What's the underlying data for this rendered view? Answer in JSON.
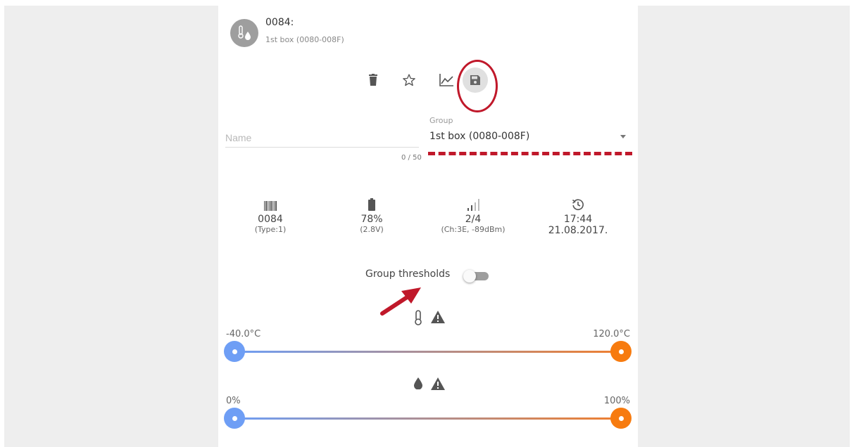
{
  "device": {
    "title": "0084:",
    "subtitle": "1st box (0080-008F)"
  },
  "name_field": {
    "placeholder": "Name",
    "value": "",
    "counter": "0 / 50"
  },
  "group_field": {
    "label": "Group",
    "value": "1st box (0080-008F)"
  },
  "stats": {
    "id": {
      "value": "0084",
      "sub": "(Type:1)"
    },
    "battery": {
      "value": "78%",
      "sub": "(2.8V)"
    },
    "signal": {
      "value": "2/4",
      "sub": "(Ch:3E, -89dBm)"
    },
    "last_seen": {
      "time": "17:44",
      "date": "21.08.2017."
    }
  },
  "group_thresholds": {
    "label": "Group thresholds",
    "enabled": false
  },
  "temperature_slider": {
    "min_label": "-40.0°C",
    "max_label": "120.0°C",
    "low_value": -40.0,
    "high_value": 120.0
  },
  "humidity_slider": {
    "min_label": "0%",
    "max_label": "100%",
    "low_value": 0,
    "high_value": 100
  },
  "colors": {
    "low_handle": "#6e9ef5",
    "high_handle": "#f77b0f",
    "annotation_red": "#c0182a"
  }
}
